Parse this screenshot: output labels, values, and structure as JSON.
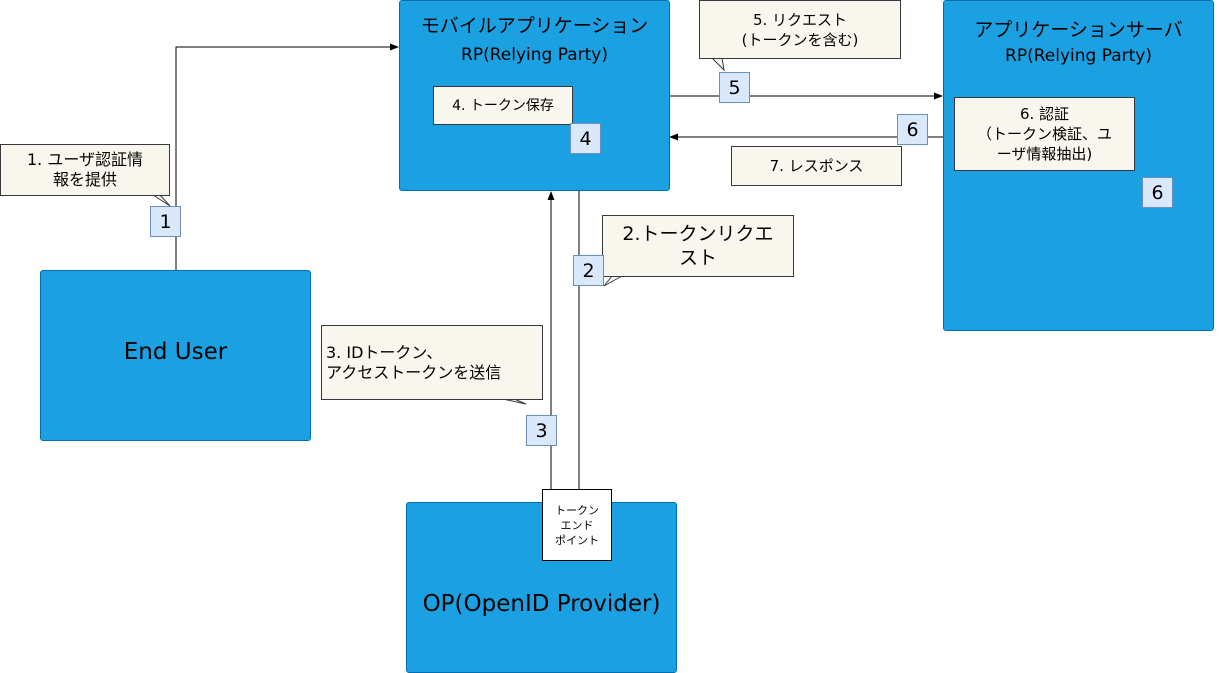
{
  "mobile_app": {
    "title": "モバイルアプリケーション",
    "subtitle": "RP(Relying Party)"
  },
  "app_server": {
    "title": "アプリケーションサーバ",
    "subtitle": "RP(Relying Party)"
  },
  "end_user": {
    "label": "End User"
  },
  "op": {
    "label": "OP(OpenID Provider)",
    "endpoint_label": "トークン\nエンド\nポイント"
  },
  "notes": {
    "step1": "1. ユーザ認証情\n報を提供",
    "step2": "2.トークンリクエ\nスト",
    "step3": "3. IDトークン、\nアクセストークンを送信",
    "step4": "4. トークン保存",
    "step5": "5. リクエスト\n(トークンを含む)",
    "step6": "6. 認証\n（トークン検証、ユ\nーザ情報抽出)",
    "step7": "7. レスポンス"
  },
  "markers": {
    "m1": "1",
    "m2": "2",
    "m3": "3",
    "m4": "4",
    "m5": "5",
    "m6a": "6",
    "m6b": "6"
  },
  "colors": {
    "box_fill": "#1ba1e2",
    "note_fill": "#f9f7ed",
    "marker_fill": "#dae8fc"
  }
}
